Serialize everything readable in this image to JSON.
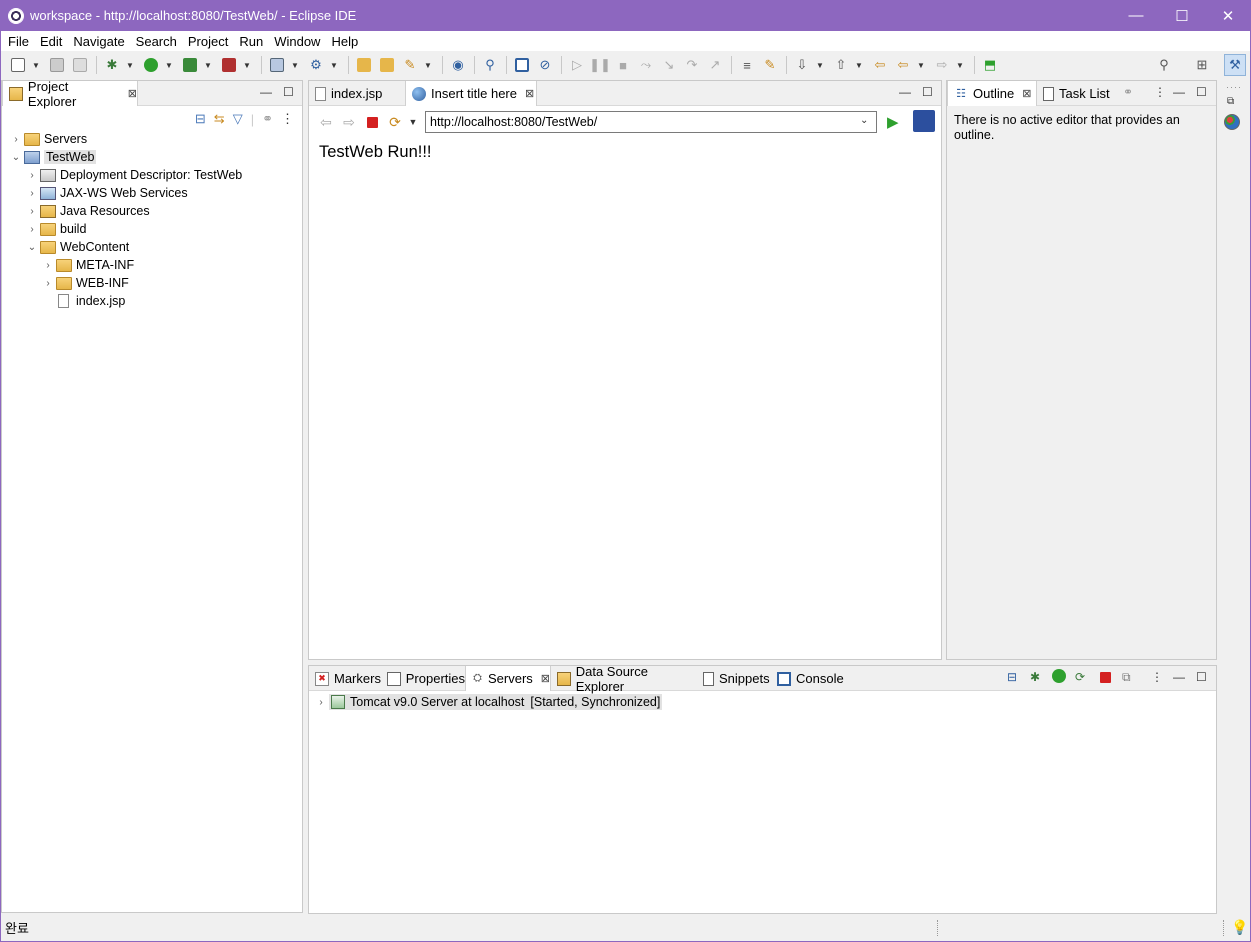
{
  "window": {
    "title": "workspace - http://localhost:8080/TestWeb/ - Eclipse IDE",
    "minimize": "—",
    "maximize": "☐",
    "close": "✕"
  },
  "menu": [
    {
      "label": "File",
      "mnemonic": "F"
    },
    {
      "label": "Edit",
      "mnemonic": "E"
    },
    {
      "label": "Navigate",
      "mnemonic": "N"
    },
    {
      "label": "Search",
      "mnemonic": "a"
    },
    {
      "label": "Project",
      "mnemonic": "P"
    },
    {
      "label": "Run",
      "mnemonic": "R"
    },
    {
      "label": "Window",
      "mnemonic": "W"
    },
    {
      "label": "Help",
      "mnemonic": "H"
    }
  ],
  "project_explorer": {
    "tab_label": "Project Explorer",
    "tree": [
      {
        "label": "Servers",
        "icon": "folder-icon",
        "expanded": false
      },
      {
        "label": "TestWeb",
        "icon": "project-icon",
        "expanded": true,
        "selected": true
      },
      {
        "label": "Deployment Descriptor: TestWeb",
        "icon": "deployment-descriptor-icon"
      },
      {
        "label": "JAX-WS Web Services",
        "icon": "web-services-icon"
      },
      {
        "label": "Java Resources",
        "icon": "java-resources-icon"
      },
      {
        "label": "build",
        "icon": "folder-icon"
      },
      {
        "label": "WebContent",
        "icon": "folder-icon",
        "expanded": true
      },
      {
        "label": "META-INF",
        "icon": "folder-icon"
      },
      {
        "label": "WEB-INF",
        "icon": "folder-icon"
      },
      {
        "label": "index.jsp",
        "icon": "file-icon"
      }
    ]
  },
  "editor": {
    "tabs": [
      {
        "label": "index.jsp",
        "active": false
      },
      {
        "label": "Insert title here",
        "active": true
      }
    ],
    "url": "http://localhost:8080/TestWeb/",
    "page_text": "TestWeb Run!!!"
  },
  "outline": {
    "tabs": [
      {
        "label": "Outline",
        "active": true
      },
      {
        "label": "Task List",
        "active": false
      }
    ],
    "message": "There is no active editor that provides an outline."
  },
  "bottom_panel": {
    "tabs": [
      {
        "label": "Markers"
      },
      {
        "label": "Properties"
      },
      {
        "label": "Servers",
        "active": true
      },
      {
        "label": "Data Source Explorer"
      },
      {
        "label": "Snippets"
      },
      {
        "label": "Console"
      }
    ],
    "servers": [
      {
        "name": "Tomcat v9.0 Server at localhost",
        "state": "[Started, Synchronized]"
      }
    ]
  },
  "status_bar": {
    "text": "완료"
  },
  "colors": {
    "titlebar": "#8d67bf",
    "run_green": "#2ea02e",
    "stop_red": "#d42020"
  }
}
